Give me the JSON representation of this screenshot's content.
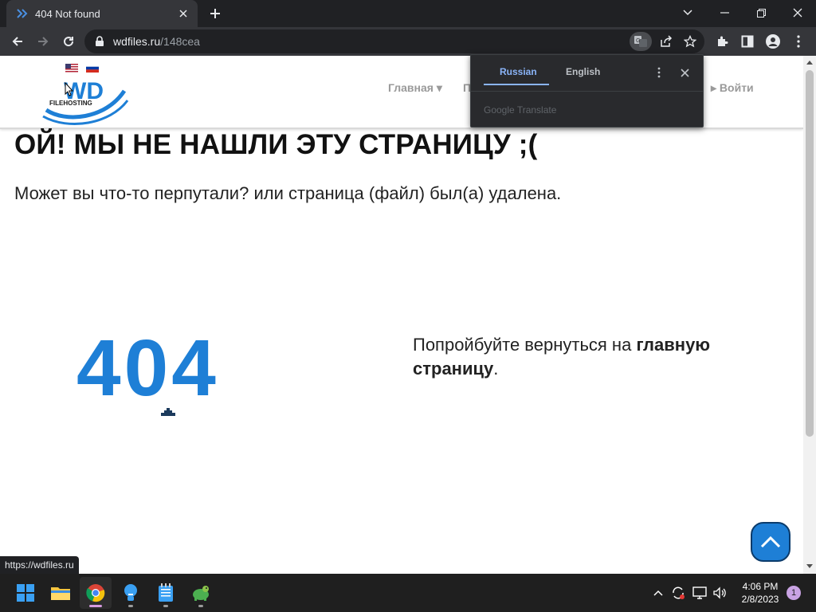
{
  "browser": {
    "tab_title": "404 Not found",
    "url_host": "wdfiles.ru",
    "url_path": "/148cea",
    "status_url": "https://wdfiles.ru"
  },
  "site": {
    "logo_text": "WD",
    "logo_subtext": "FILEHOSTING",
    "nav": {
      "home_label": "Главная",
      "partial_label": "П",
      "login_label": "Войти"
    },
    "heading": "ОЙ! МЫ НЕ НАШЛИ ЭТУ СТРАНИЦУ ;(",
    "subheading": "Может вы что-то перпутали? или страница (файл) был(а) удалена.",
    "big_404": "404",
    "try_prefix": "Попройбуйте вернуться на ",
    "try_link": "главную страницу",
    "try_suffix": ".",
    "accent_color": "#1e7fd6"
  },
  "translate_popup": {
    "tab_source": "Russian",
    "tab_target": "English",
    "footer": "Google Translate"
  },
  "taskbar": {
    "time": "4:06 PM",
    "date": "2/8/2023",
    "notification_count": "1"
  }
}
